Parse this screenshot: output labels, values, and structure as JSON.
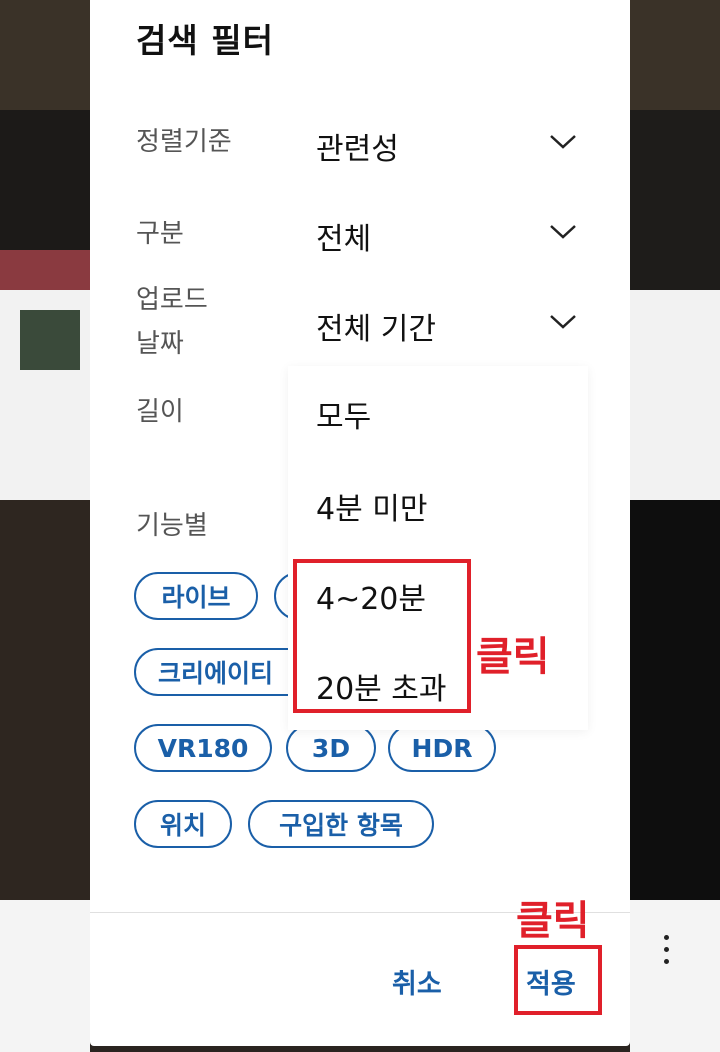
{
  "dialog": {
    "title": "검색 필터"
  },
  "filters": [
    {
      "label": "정렬기준",
      "value": "관련성"
    },
    {
      "label": "구분",
      "value": "전체"
    },
    {
      "label_line1": "업로드",
      "label_line2": "날짜",
      "value": "전체 기간"
    },
    {
      "label": "길이"
    }
  ],
  "features": {
    "label": "기능별",
    "chips": [
      "라이브",
      "크리에이티",
      "VR180",
      "3D",
      "HDR",
      "위치",
      "구입한 항목"
    ]
  },
  "length_dropdown": {
    "options": [
      "모두",
      "4분 미만",
      "4~20분",
      "20분 초과"
    ]
  },
  "actions": {
    "cancel": "취소",
    "apply": "적용"
  },
  "annotations": {
    "click1": "클릭",
    "click2": "클릭"
  },
  "colors": {
    "accent": "#1a5fa8",
    "annotation_red": "#e0202a"
  }
}
